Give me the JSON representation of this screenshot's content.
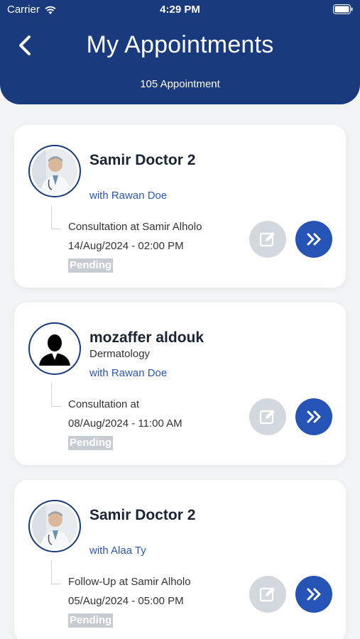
{
  "status_bar": {
    "carrier": "Carrier",
    "time": "4:29 PM"
  },
  "header": {
    "title": "My Appointments",
    "subtitle": "105 Appointment"
  },
  "colors": {
    "header": "#1a3a7e",
    "accent": "#2553b6",
    "link": "#2a57b8",
    "pending_bg": "#c7ccd3"
  },
  "appointments": [
    {
      "doctor": "Samir Doctor 2",
      "specialty": "",
      "patient": "with Rawan Doe",
      "place": "Consultation at Samir Alholo",
      "datetime": "14/Aug/2024 - 02:00 PM",
      "status": "Pending",
      "avatar": "doctor-photo"
    },
    {
      "doctor": "mozaffer aldouk",
      "specialty": "Dermatology",
      "patient": "with Rawan Doe",
      "place": "Consultation at",
      "datetime": "08/Aug/2024 - 11:00 AM",
      "status": "Pending",
      "avatar": "person-silhouette"
    },
    {
      "doctor": "Samir Doctor 2",
      "specialty": "",
      "patient": "with Alaa Ty",
      "place": "Follow-Up at Samir Alholo",
      "datetime": "05/Aug/2024 - 05:00 PM",
      "status": "Pending",
      "avatar": "doctor-photo"
    }
  ]
}
